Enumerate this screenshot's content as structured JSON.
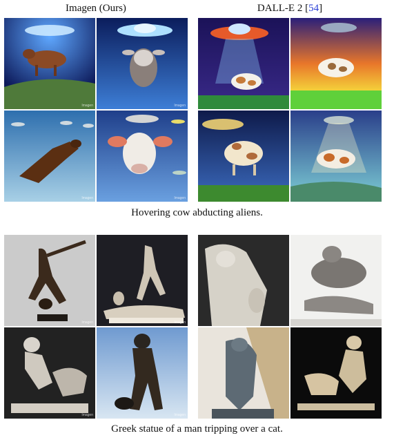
{
  "header": {
    "left_label": "Imagen (Ours)",
    "right_label": "DALL-E 2 [",
    "right_ref": "54",
    "right_close": "]"
  },
  "groups": [
    {
      "caption": "Hovering cow abducting aliens."
    },
    {
      "caption": "Greek statue of a man tripping over a cat."
    }
  ],
  "watermark": "Imagen"
}
